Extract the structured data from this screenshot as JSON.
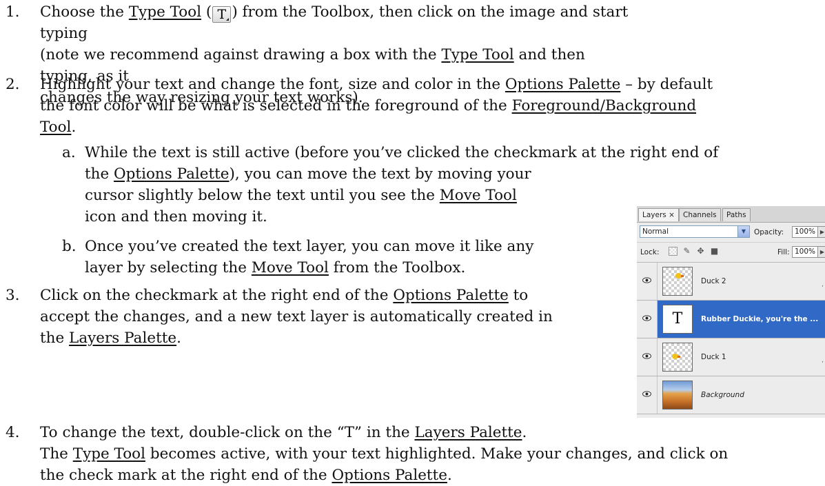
{
  "steps": [
    {
      "num": "1.",
      "pre": "Choose the ",
      "link1": "Type Tool",
      "mid": " (",
      "icon_letter": "T",
      "post": ") from the Toolbox, then click on the image and start typing",
      "line2": "(note we recommend against drawing a box with the ",
      "link2": "Type Tool",
      "line2_post": " and then typing, as it",
      "line3": "changes the way resizing your text works)."
    },
    {
      "num": "2.",
      "line1_pre": "Highlight your text and change the font, size and color in the ",
      "link1": "Options Palette",
      "line1_post": " – by default",
      "line2_pre": "the font color will be what is selected in the foreground of the ",
      "link2": "Foreground/Background",
      "link2b": "Tool",
      "line3_post": "."
    },
    {
      "num": "a.",
      "line1": "While the text is still active (before you’ve clicked the checkmark at the right end of",
      "line2_pre": "the ",
      "link1": "Options Palette",
      "line2_post": "), you can move the text by moving your",
      "line3_pre": "cursor slightly below the text until you see the ",
      "link2": "Move Tool",
      "line4": "icon and then moving it."
    },
    {
      "num": "b.",
      "line1": "Once you’ve created the text layer, you can move it like any",
      "line2_pre": "layer by selecting the ",
      "link1": "Move Tool",
      "line2_post": " from the Toolbox."
    },
    {
      "num": "3.",
      "line1_pre": "Click on the checkmark at the right end of the ",
      "link1": "Options Palette",
      "line1_post": " to",
      "line2": "accept the changes, and a new text layer is automatically created in",
      "line3_pre": "the ",
      "link2": "Layers Palette",
      "line3_post": "."
    },
    {
      "num": "4.",
      "line1_pre": "To change the text, double-click on the “T” in the ",
      "link1": "Layers Palette",
      "line1_post": ".",
      "line2_pre": "The ",
      "link2": "Type Tool",
      "line2_post": " becomes active, with your text highlighted. Make your changes, and click on",
      "line3_pre": "the check mark at the right end of the ",
      "link3": "Options Palette",
      "line3_post": "."
    }
  ],
  "layers_palette": {
    "tabs": [
      "Layers ×",
      "Channels",
      "Paths"
    ],
    "blend_mode": "Normal",
    "opacity_label": "Opacity:",
    "opacity_value": "100%",
    "lock_label": "Lock:",
    "fill_label": "Fill:",
    "fill_value": "100%",
    "layers": [
      {
        "name": "Duck 2",
        "thumb": "checker",
        "selected": false
      },
      {
        "name": "Rubber Duckie, you're the ...",
        "thumb_text": "T",
        "selected": true
      },
      {
        "name": "Duck 1",
        "thumb": "checker",
        "selected": false
      },
      {
        "name": "Background",
        "thumb": "background",
        "selected": false
      }
    ]
  },
  "colors": {
    "selection": "#3169c6",
    "text": "#111111"
  }
}
